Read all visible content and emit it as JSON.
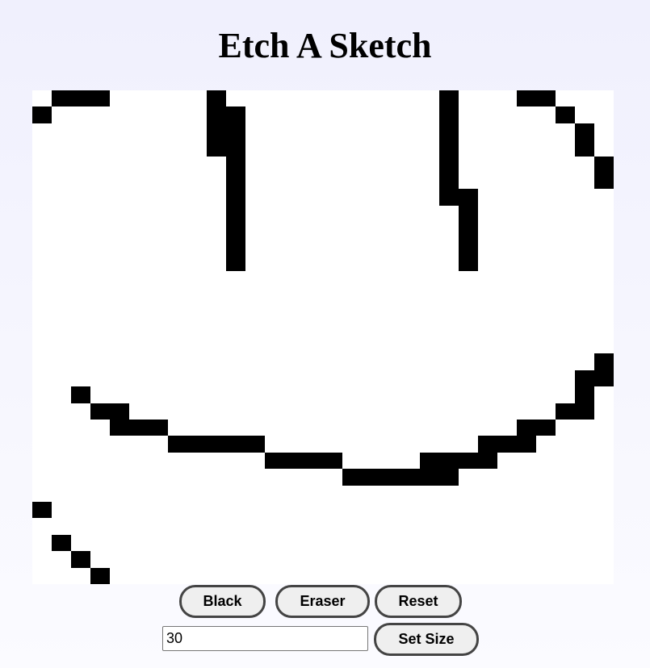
{
  "app": {
    "title": "Etch A Sketch"
  },
  "grid": {
    "columns": 30,
    "rows": 30,
    "filled_color": "#000000",
    "empty_color": "#ffffff",
    "filled_cells": [
      [
        1,
        0
      ],
      [
        2,
        0
      ],
      [
        3,
        0
      ],
      [
        9,
        0
      ],
      [
        21,
        0
      ],
      [
        25,
        0
      ],
      [
        26,
        0
      ],
      [
        0,
        1
      ],
      [
        9,
        1
      ],
      [
        10,
        1
      ],
      [
        21,
        1
      ],
      [
        27,
        1
      ],
      [
        9,
        2
      ],
      [
        10,
        2
      ],
      [
        21,
        2
      ],
      [
        28,
        2
      ],
      [
        9,
        3
      ],
      [
        10,
        3
      ],
      [
        21,
        3
      ],
      [
        28,
        3
      ],
      [
        10,
        4
      ],
      [
        21,
        4
      ],
      [
        29,
        4
      ],
      [
        10,
        5
      ],
      [
        21,
        5
      ],
      [
        29,
        5
      ],
      [
        10,
        6
      ],
      [
        21,
        6
      ],
      [
        22,
        6
      ],
      [
        10,
        7
      ],
      [
        22,
        7
      ],
      [
        10,
        8
      ],
      [
        22,
        8
      ],
      [
        10,
        9
      ],
      [
        22,
        9
      ],
      [
        10,
        10
      ],
      [
        22,
        10
      ],
      [
        29,
        16
      ],
      [
        28,
        17
      ],
      [
        29,
        17
      ],
      [
        2,
        18
      ],
      [
        28,
        18
      ],
      [
        3,
        19
      ],
      [
        4,
        19
      ],
      [
        27,
        19
      ],
      [
        28,
        19
      ],
      [
        4,
        20
      ],
      [
        5,
        20
      ],
      [
        6,
        20
      ],
      [
        25,
        20
      ],
      [
        26,
        20
      ],
      [
        7,
        21
      ],
      [
        8,
        21
      ],
      [
        9,
        21
      ],
      [
        10,
        21
      ],
      [
        11,
        21
      ],
      [
        23,
        21
      ],
      [
        24,
        21
      ],
      [
        25,
        21
      ],
      [
        12,
        22
      ],
      [
        13,
        22
      ],
      [
        14,
        22
      ],
      [
        15,
        22
      ],
      [
        20,
        22
      ],
      [
        21,
        22
      ],
      [
        22,
        22
      ],
      [
        23,
        22
      ],
      [
        16,
        23
      ],
      [
        17,
        23
      ],
      [
        18,
        23
      ],
      [
        19,
        23
      ],
      [
        20,
        23
      ],
      [
        21,
        23
      ],
      [
        0,
        25
      ],
      [
        1,
        27
      ],
      [
        2,
        28
      ],
      [
        3,
        29
      ]
    ]
  },
  "controls": {
    "black_label": "Black",
    "eraser_label": "Eraser",
    "reset_label": "Reset",
    "size_value": "30",
    "set_size_label": "Set Size"
  }
}
